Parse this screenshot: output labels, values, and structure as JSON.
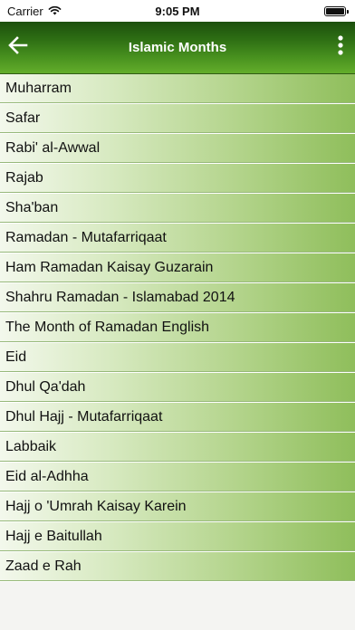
{
  "status_bar": {
    "carrier": "Carrier",
    "time": "9:05 PM"
  },
  "header": {
    "title": "Islamic Months"
  },
  "months": [
    "Muharram",
    "Safar",
    "Rabi' al-Awwal",
    "Rajab",
    "Sha'ban",
    "Ramadan - Mutafarriqaat",
    "Ham Ramadan Kaisay Guzarain",
    "Shahru Ramadan - Islamabad 2014",
    "The Month of Ramadan English",
    "Eid",
    "Dhul Qa'dah",
    "Dhul Hajj - Mutafarriqaat",
    "Labbaik",
    "Eid al-Adhha",
    "Hajj o 'Umrah Kaisay Karein",
    "Hajj e Baitullah",
    "Zaad e Rah"
  ]
}
